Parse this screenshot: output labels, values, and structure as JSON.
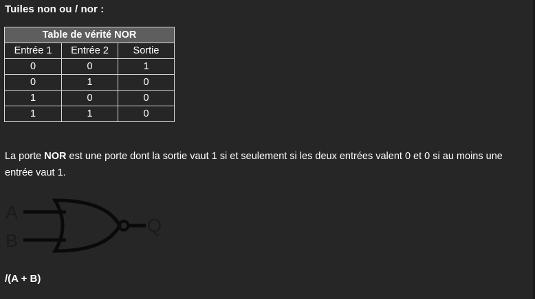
{
  "heading": "Tuiles non ou / nor :",
  "table": {
    "caption": "Table de vérité NOR",
    "headers": [
      "Entrée 1",
      "Entrée 2",
      "Sortie"
    ],
    "rows": [
      [
        "0",
        "0",
        "1"
      ],
      [
        "0",
        "1",
        "0"
      ],
      [
        "1",
        "0",
        "0"
      ],
      [
        "1",
        "1",
        "0"
      ]
    ]
  },
  "paragraph": {
    "before": "La porte ",
    "bold": "NOR",
    "after": " est une porte dont la sortie vaut 1 si et seulement si les deux entrées valent 0 et 0 si au moins une entrée vaut 1."
  },
  "gate": {
    "input_a": "A",
    "input_b": "B",
    "output": "Q",
    "icon": "nor-gate-icon"
  },
  "formula": "/(A + B)"
}
